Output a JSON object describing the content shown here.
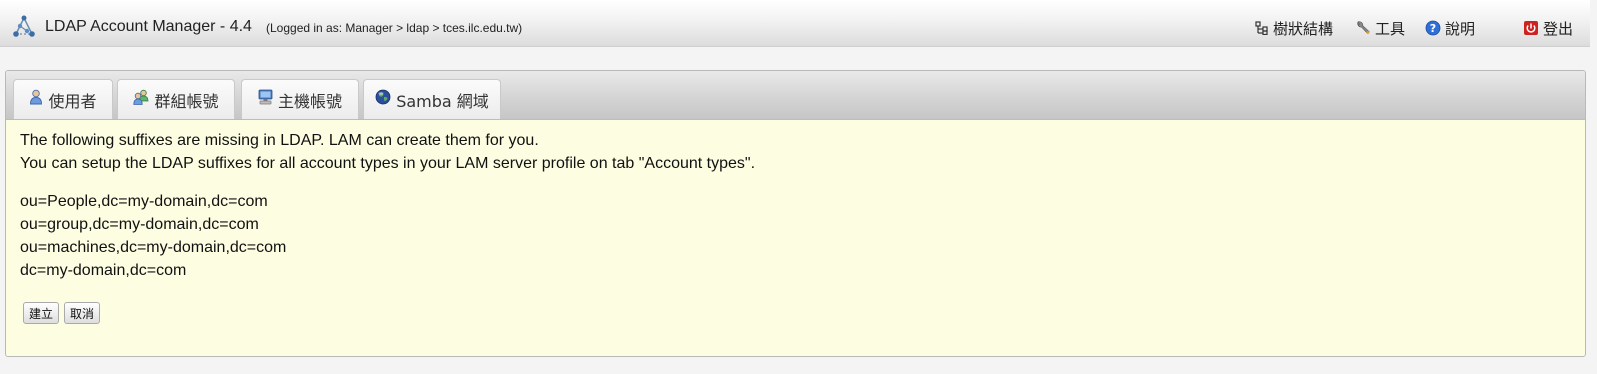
{
  "header": {
    "app_title": "LDAP Account Manager - 4.4",
    "login_info": "(Logged in as: Manager > ldap > tces.ilc.edu.tw)",
    "links": {
      "tree": "樹狀結構",
      "tools": "工具",
      "help": "說明",
      "logout": "登出"
    },
    "icons": {
      "logo": "lam-logo-icon",
      "tree": "tree-view-icon",
      "tools": "wrench-tools-icon",
      "help": "help-question-icon",
      "logout": "power-logout-icon"
    },
    "colors": {
      "help": "#2f6fd6",
      "logout": "#cc2222"
    }
  },
  "tabs": [
    {
      "label": "使用者",
      "icon": "user-icon"
    },
    {
      "label": "群組帳號",
      "icon": "group-icon"
    },
    {
      "label": "主機帳號",
      "icon": "computer-icon"
    },
    {
      "label": "Samba 網域",
      "icon": "globe-icon"
    }
  ],
  "message": {
    "line1": "The following suffixes are missing in LDAP. LAM can create them for you.",
    "line2": "You can setup the LDAP suffixes for all account types in your LAM server profile on tab \"Account types\"."
  },
  "suffixes": [
    "ou=People,dc=my-domain,dc=com",
    "ou=group,dc=my-domain,dc=com",
    "ou=machines,dc=my-domain,dc=com",
    "dc=my-domain,dc=com"
  ],
  "buttons": {
    "create": "建立",
    "cancel": "取消"
  },
  "colors": {
    "content_background": "#fdfde2"
  }
}
